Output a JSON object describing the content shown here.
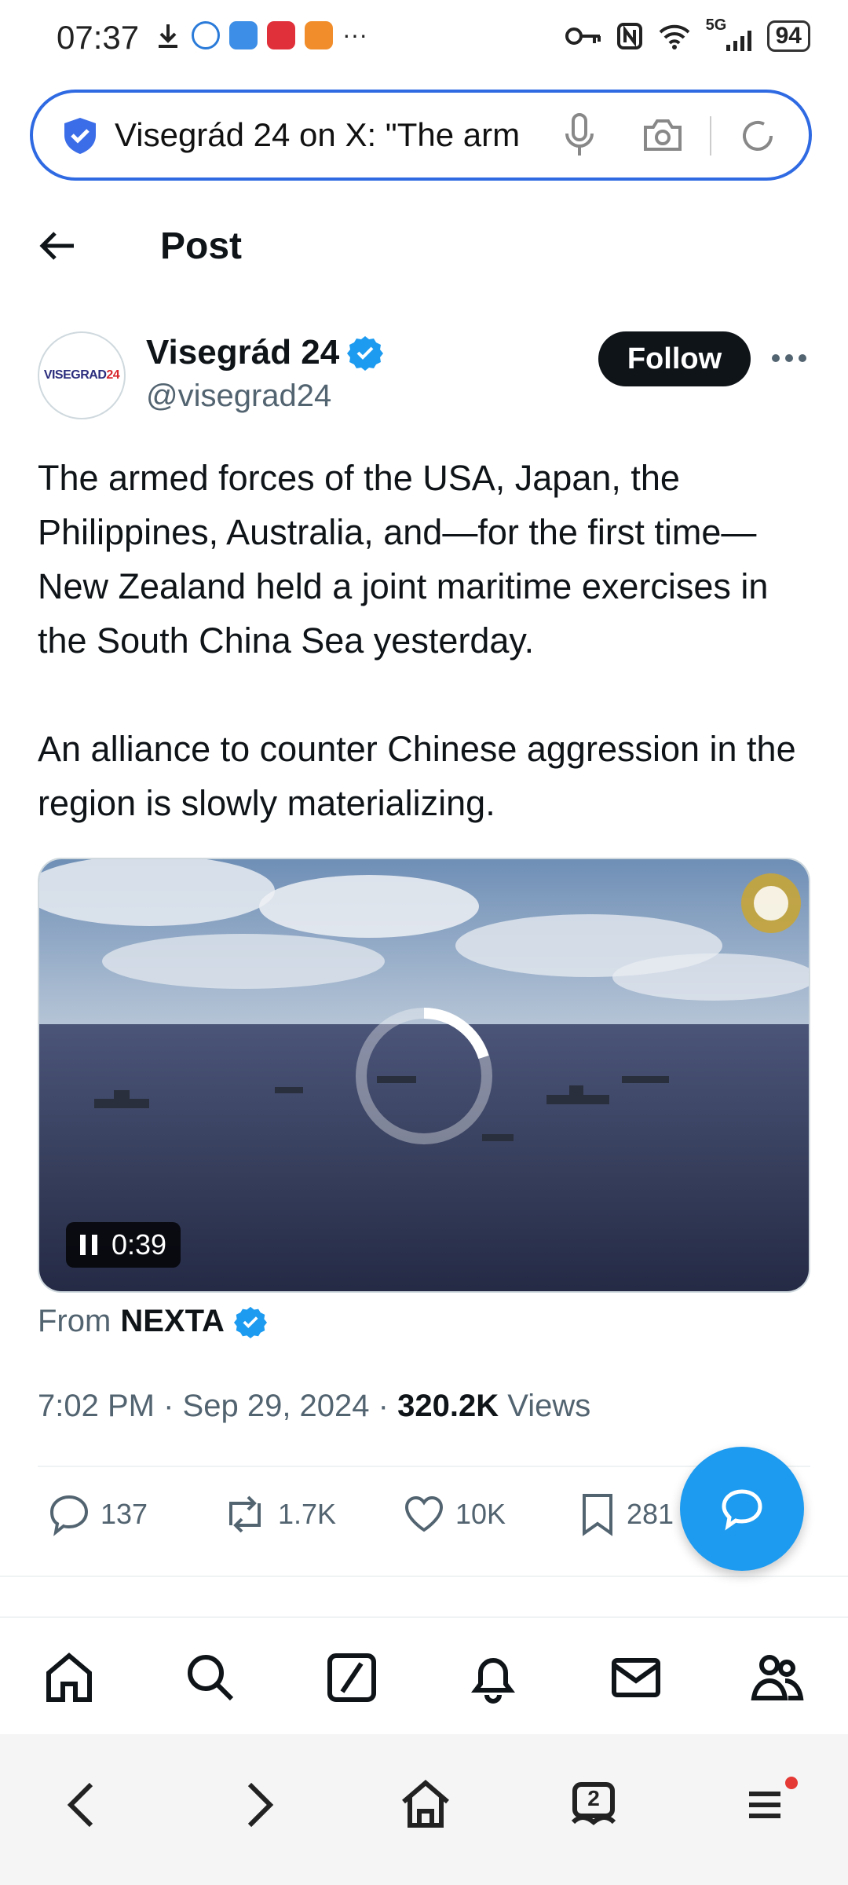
{
  "status_bar": {
    "time": "07:37",
    "network": "5G",
    "battery": "94",
    "more": "···"
  },
  "browser": {
    "url_title": "Visegrád 24 on X: \"The arm"
  },
  "page": {
    "title": "Post"
  },
  "author": {
    "avatar_text_left": "VISEGRAD",
    "avatar_text_right": "24",
    "name": "Visegrád 24",
    "handle": "@visegrad24",
    "follow_label": "Follow"
  },
  "tweet": {
    "paragraph_1": "The armed forces of the USA, Japan, the Philippines, Australia, and—for the first time—New Zealand held a joint maritime exercises in the South China Sea yesterday.",
    "paragraph_2": "An alliance to counter Chinese aggression in the region is slowly materializing."
  },
  "media": {
    "duration": "0:39",
    "source_prefix": "From",
    "source_name": "NEXTA"
  },
  "meta": {
    "time": "7:02 PM",
    "separator": "·",
    "date": "Sep 29, 2024",
    "views_count": "320.2K",
    "views_label": "Views"
  },
  "actions": {
    "replies": "137",
    "reposts": "1.7K",
    "likes": "10K",
    "bookmarks": "281"
  },
  "colors": {
    "accent": "#1d9bf0",
    "follow_bg": "#0f1419",
    "secondary_text": "#536471",
    "address_border": "#2f6ae3"
  },
  "icons": {
    "back": "arrow-left-icon",
    "verified": "verified-badge-icon",
    "more": "more-horizontal-icon",
    "reply": "reply-bubble-icon",
    "repost": "repost-icon",
    "like": "heart-icon",
    "bookmark": "bookmark-icon",
    "fab": "new-message-icon",
    "nav": [
      "home-icon",
      "search-icon",
      "grok-icon",
      "bell-icon",
      "mail-icon",
      "communities-icon"
    ],
    "browser": [
      "back-icon",
      "forward-icon",
      "home-icon",
      "tabs-icon",
      "menu-icon"
    ]
  },
  "browser_bar": {
    "tab_count": "2"
  }
}
